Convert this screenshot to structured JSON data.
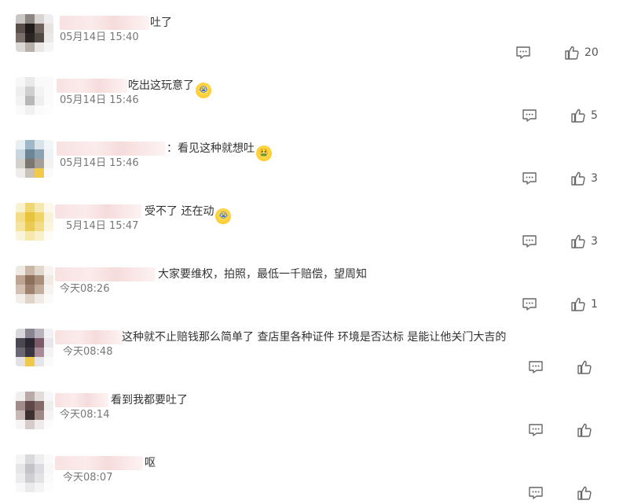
{
  "comments": [
    {
      "text": "吐了",
      "emoji": "",
      "time": "05月14日 15:40",
      "likes": "20"
    },
    {
      "text": "吃出这玩意了",
      "emoji": "crying-face-emoji",
      "time": "05月14日 15:46",
      "likes": "5"
    },
    {
      "text": "：看见这种就想吐",
      "emoji": "nauseated-face-emoji",
      "time": "05月14日 15:46",
      "likes": "3"
    },
    {
      "text": "受不了 还在动",
      "emoji": "crying-face-emoji",
      "time": "5月14日 15:47",
      "likes": "3"
    },
    {
      "text": "大家要维权，拍照，最低一千赔偿，望周知",
      "emoji": "",
      "time": "今天08:26",
      "likes": "1"
    },
    {
      "text": "这种就不止赔钱那么简单了 查店里各种证件 环境是否达标 是能让他关门大吉的",
      "emoji": "",
      "time": "今天08:48",
      "likes": ""
    },
    {
      "text": "看到我都要吐了",
      "emoji": "",
      "time": "今天08:14",
      "likes": ""
    },
    {
      "text": "呕",
      "emoji": "",
      "time": "今天08:07",
      "likes": ""
    }
  ]
}
